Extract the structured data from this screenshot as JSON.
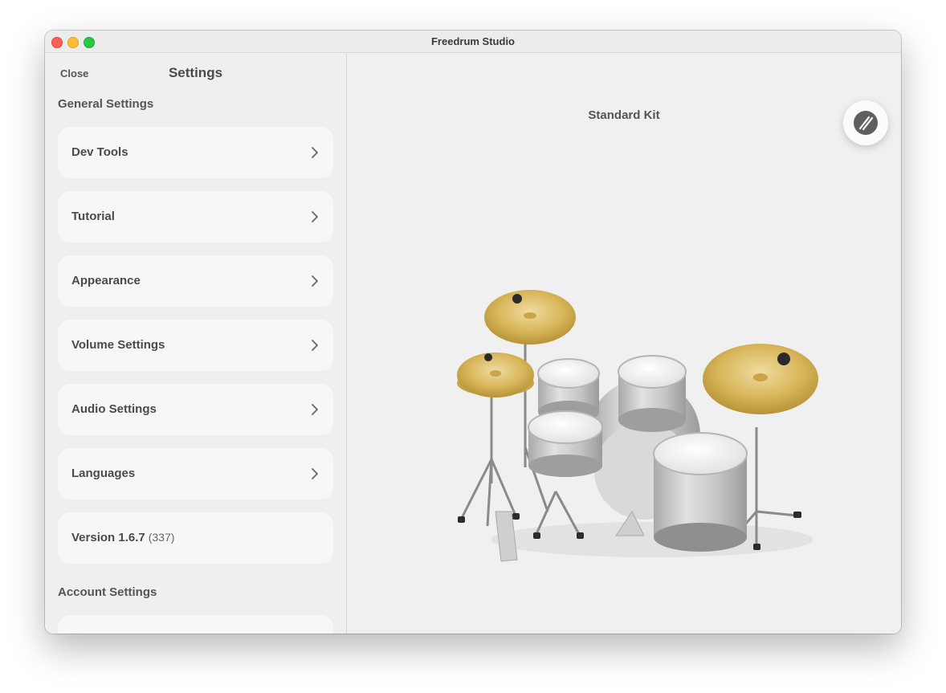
{
  "window": {
    "title": "Freedrum Studio"
  },
  "sidebar": {
    "close_label": "Close",
    "title": "Settings",
    "general_heading": "General Settings",
    "items": [
      {
        "label": "Dev Tools"
      },
      {
        "label": "Tutorial"
      },
      {
        "label": "Appearance"
      },
      {
        "label": "Volume Settings"
      },
      {
        "label": "Audio Settings"
      },
      {
        "label": "Languages"
      }
    ],
    "version": {
      "label": "Version 1.6.7",
      "build": "(337)"
    },
    "account_heading": "Account Settings"
  },
  "main": {
    "kit_name": "Standard Kit",
    "fab_icon": "drumsticks-icon"
  },
  "colors": {
    "cymbal_gold": "#d9b85e",
    "drum_shell": "#c9c9c9",
    "drum_head": "#f4f4f4"
  }
}
